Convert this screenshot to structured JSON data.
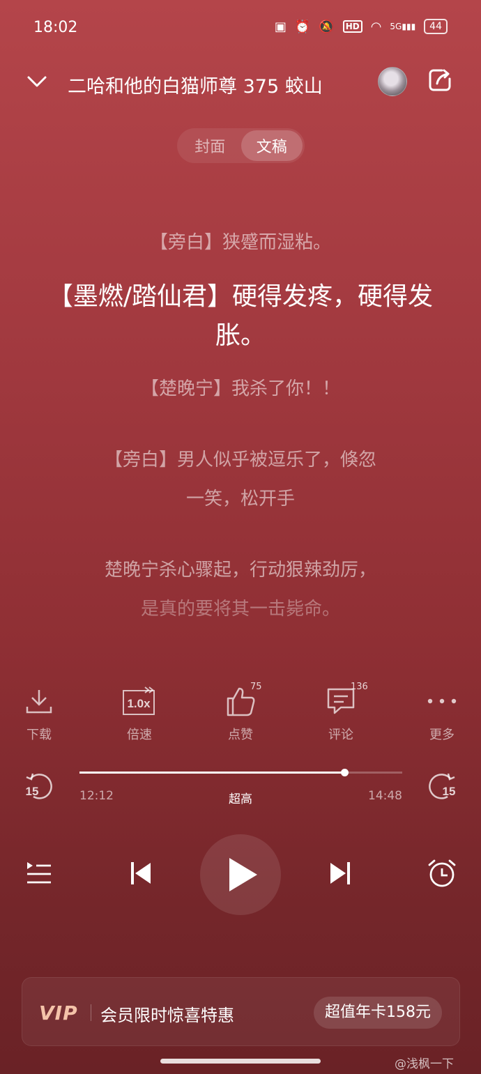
{
  "status": {
    "time": "18:02",
    "battery": "44",
    "network": "5G",
    "hd": "HD"
  },
  "header": {
    "title": "二哈和他的白猫师尊 375 蛟山"
  },
  "tabs": [
    "封面",
    "文稿"
  ],
  "lyrics": [
    "【旁白】狭蹙而湿粘。",
    "【墨燃/踏仙君】硬得发疼，硬得发胀。",
    "【楚晚宁】我杀了你！！",
    "【旁白】男人似乎被逗乐了，倏忽",
    "一笑，松开手",
    "楚晚宁杀心骤起，行动狠辣劲厉，",
    "是真的要将其一击毙命。"
  ],
  "actions": {
    "download": "下载",
    "speed": "倍速",
    "speed_value": "1.0x",
    "like": "点赞",
    "like_count": "75",
    "comment": "评论",
    "comment_count": "136",
    "more": "更多"
  },
  "progress": {
    "current": "12:12",
    "total": "14:48",
    "quality": "超高",
    "fraction": 0.82,
    "skip_seconds": "15"
  },
  "vip": {
    "logo": "VIP",
    "text": "会员限时惊喜特惠",
    "button": "超值年卡158元"
  },
  "watermark": "@浅枫一下"
}
